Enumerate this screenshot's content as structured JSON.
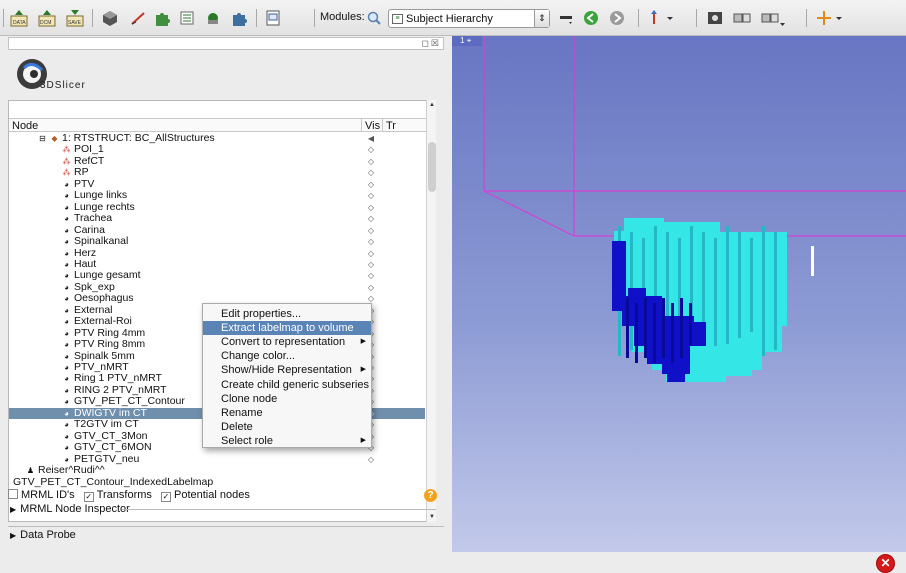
{
  "toolbar": {
    "modules_label": "Modules:",
    "module_selected": "Subject Hierarchy",
    "icons": [
      "load-data-icon",
      "load-dicom-icon",
      "save-data-icon",
      "module-3d-icon",
      "module-editor-icon",
      "module-extension-icon",
      "module-list-icon",
      "module-annotation-icon",
      "module-volumes-icon",
      "python-console-icon",
      "search-icon",
      "back-arrow-icon",
      "forward-arrow-icon",
      "mouse-mode-icon",
      "screenshot-icon",
      "layout-icon",
      "layout-dropdown-icon",
      "crosshair-icon"
    ]
  },
  "logo": {
    "name": "3DSlicer"
  },
  "tree": {
    "headers": {
      "node": "Node",
      "vis": "Vis",
      "tr": "Tr"
    },
    "rows": [
      {
        "label": "1: RTSTRUCT: BC_AllStructures",
        "icon": "study-icon",
        "indent": 3,
        "expander": "⊟"
      },
      {
        "label": "POI_1",
        "icon": "fiducial-icon",
        "indent": 4
      },
      {
        "label": "RefCT",
        "icon": "fiducial-icon",
        "indent": 4
      },
      {
        "label": "RP",
        "icon": "fiducial-icon",
        "indent": 4
      },
      {
        "label": "PTV",
        "icon": "contour-icon",
        "indent": 4
      },
      {
        "label": "Lunge links",
        "icon": "contour-icon",
        "indent": 4
      },
      {
        "label": "Lunge rechts",
        "icon": "contour-icon",
        "indent": 4
      },
      {
        "label": "Trachea",
        "icon": "contour-icon",
        "indent": 4
      },
      {
        "label": "Carina",
        "icon": "contour-icon",
        "indent": 4
      },
      {
        "label": "Spinalkanal",
        "icon": "contour-icon",
        "indent": 4
      },
      {
        "label": "Herz",
        "icon": "contour-icon",
        "indent": 4
      },
      {
        "label": "Haut",
        "icon": "contour-icon",
        "indent": 4
      },
      {
        "label": "Lunge gesamt",
        "icon": "contour-icon",
        "indent": 4
      },
      {
        "label": "Spk_exp",
        "icon": "contour-icon",
        "indent": 4
      },
      {
        "label": "Oesophagus",
        "icon": "contour-icon",
        "indent": 4
      },
      {
        "label": "External",
        "icon": "contour-icon",
        "indent": 4
      },
      {
        "label": "External-Roi",
        "icon": "contour-icon",
        "indent": 4
      },
      {
        "label": "PTV Ring 4mm",
        "icon": "contour-icon",
        "indent": 4
      },
      {
        "label": "PTV Ring 8mm",
        "icon": "contour-icon",
        "indent": 4
      },
      {
        "label": "Spinalk 5mm",
        "icon": "contour-icon",
        "indent": 4
      },
      {
        "label": "PTV_nMRT",
        "icon": "contour-icon",
        "indent": 4
      },
      {
        "label": "Ring 1 PTV_nMRT",
        "icon": "contour-icon",
        "indent": 4
      },
      {
        "label": "RING 2 PTV_nMRT",
        "icon": "contour-icon",
        "indent": 4
      },
      {
        "label": "GTV_PET_CT_Contour",
        "icon": "contour-icon",
        "indent": 4
      },
      {
        "label": "DWIGTV im CT",
        "icon": "contour-icon",
        "indent": 4,
        "selected": true
      },
      {
        "label": "T2GTV im CT",
        "icon": "contour-icon",
        "indent": 4
      },
      {
        "label": "GTV_CT_3Mon",
        "icon": "contour-icon",
        "indent": 4
      },
      {
        "label": "GTV_CT_6MON",
        "icon": "contour-icon",
        "indent": 4
      },
      {
        "label": "PETGTV_neu",
        "icon": "contour-icon",
        "indent": 4
      },
      {
        "label": "Reiser^Rudi^^",
        "icon": "patient-icon",
        "indent": 1
      },
      {
        "label": "GTV_PET_CT_Contour_IndexedLabelmap",
        "icon": "none",
        "indent": 0
      }
    ]
  },
  "options": {
    "mrml_ids": "MRML ID's",
    "transforms": "Transforms",
    "potential_nodes": "Potential nodes",
    "inspector": "MRML Node Inspector",
    "data_probe": "Data Probe"
  },
  "context_menu": {
    "items": [
      {
        "label": "Edit properties...",
        "submenu": false
      },
      {
        "label": "Extract labelmap to volume node",
        "submenu": false,
        "highlighted": true
      },
      {
        "label": "Convert to representation",
        "submenu": true
      },
      {
        "label": "Change color...",
        "submenu": false
      },
      {
        "label": "Show/Hide Representation",
        "submenu": true
      },
      {
        "label": "Create child generic subseries",
        "submenu": false
      },
      {
        "label": "Clone node",
        "submenu": false
      },
      {
        "label": "Rename",
        "submenu": false
      },
      {
        "label": "Delete",
        "submenu": false
      },
      {
        "label": "Select role",
        "submenu": true
      }
    ]
  },
  "view3d": {
    "label": "1",
    "box_color": "#d43fd4",
    "colors": {
      "cyan": "#34e6e6",
      "blue": "#1010c8"
    }
  }
}
